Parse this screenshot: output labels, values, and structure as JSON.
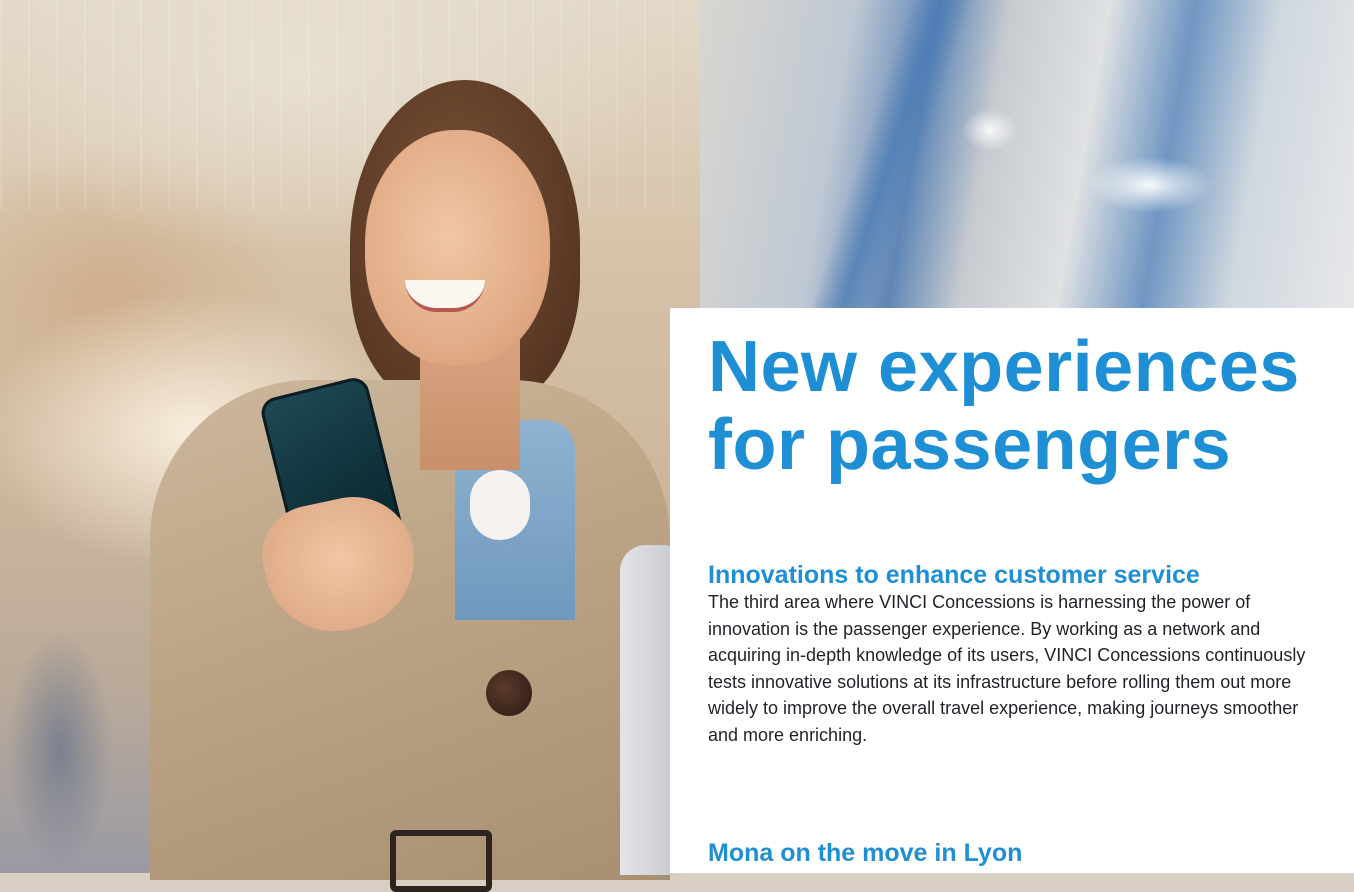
{
  "article": {
    "headline_line1": "New experiences",
    "headline_line2": "for passengers",
    "sections": [
      {
        "title": "Innovations to enhance customer service",
        "body": "The third area where VINCI Concessions is harnessing the power of innovation is the passenger experience. By working as a network and acquiring in-depth knowledge of its users, VINCI Concessions continuously tests innovative solutions at its infrastructure before rolling them out more widely to improve the overall travel experience, making journeys smoother and more enriching."
      },
      {
        "title": "Mona on the move in Lyon"
      }
    ]
  },
  "colors": {
    "accent": "#1e8fd5",
    "text": "#1f2328",
    "panel": "#ffffff"
  }
}
